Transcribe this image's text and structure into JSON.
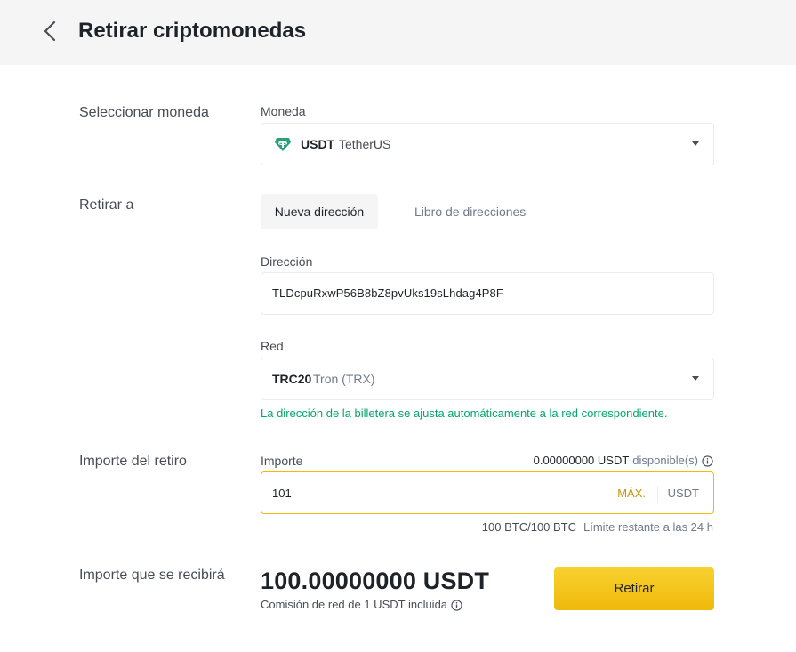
{
  "header": {
    "title": "Retirar criptomonedas"
  },
  "currency_section": {
    "label": "Seleccionar moneda",
    "field_label": "Moneda",
    "symbol": "USDT",
    "name": "TetherUS",
    "icon": "tether-icon"
  },
  "withdraw_to": {
    "label": "Retirar a",
    "tabs": [
      {
        "label": "Nueva dirección",
        "active": true
      },
      {
        "label": "Libro de direcciones",
        "active": false
      }
    ],
    "address_label": "Dirección",
    "address_value": "TLDcpuRxwP56B8bZ8pvUks19sLhdag4P8F",
    "network_label": "Red",
    "network_symbol": "TRC20",
    "network_name": "Tron (TRX)",
    "network_hint": "La dirección de la billetera se ajusta automáticamente a la red correspondiente."
  },
  "amount_section": {
    "label": "Importe del retiro",
    "field_label": "Importe",
    "available_amount": "0.00000000 USDT",
    "available_text": "disponible(s)",
    "value": "101",
    "max_label": "MÁX.",
    "unit": "USDT",
    "limit_value": "100 BTC/100 BTC",
    "limit_text": "Límite restante a las 24 h"
  },
  "receive_section": {
    "label": "Importe que se recibirá",
    "amount": "100.00000000 USDT",
    "fee_text": "Comisión de red de 1 USDT incluida",
    "submit_label": "Retirar"
  },
  "colors": {
    "accent": "#f0b90b",
    "success": "#03a66d",
    "tether": "#26a17b"
  }
}
